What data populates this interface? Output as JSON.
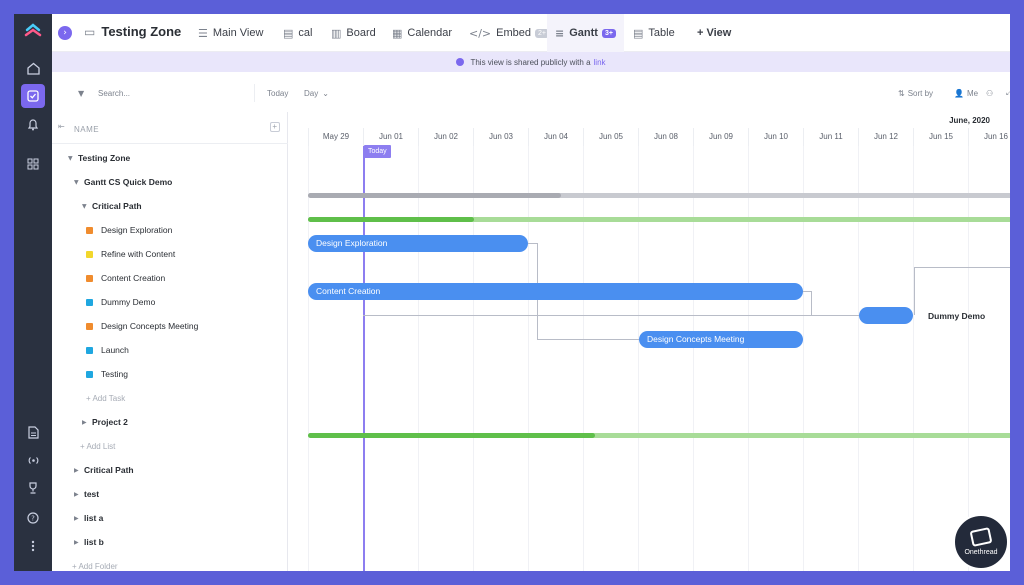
{
  "colors": {
    "accent": "#7b68ee",
    "bar_blue": "#4a8ff0",
    "green_dark": "#5fbf4a",
    "green_light": "#a8dc98",
    "progress_gray": "#b0b3bb",
    "status_orange": "#f08c2e",
    "status_yellow": "#f2d72c",
    "status_cyan": "#1fa7e0"
  },
  "rail": {
    "icons": [
      "home-icon",
      "tasks-icon",
      "bell-icon",
      "dashboard-icon",
      "doc-icon",
      "broadcast-icon",
      "trophy-icon",
      "help-icon",
      "more-icon"
    ]
  },
  "topbar": {
    "space_title": "Testing Zone",
    "tabs": [
      {
        "label": "Main View",
        "icon": "list-icon"
      },
      {
        "label": "cal",
        "icon": "stack-icon"
      },
      {
        "label": "Board",
        "icon": "board-icon"
      },
      {
        "label": "Calendar",
        "icon": "calendar-icon"
      },
      {
        "label": "Embed",
        "icon": "code-icon",
        "badge": "2+"
      },
      {
        "label": "Gantt",
        "icon": "gantt-icon",
        "badge": "3+"
      },
      {
        "label": "Table",
        "icon": "table-icon"
      }
    ],
    "add_view": "+ View"
  },
  "banner": {
    "text": "This view is shared publicly with a",
    "link": "link"
  },
  "toolbar": {
    "search_placeholder": "Search...",
    "today": "Today",
    "day": "Day",
    "sort_by": "Sort by",
    "me": "Me"
  },
  "list": {
    "header": "NAME",
    "rows": [
      {
        "label": "Testing Zone",
        "kind": "folder"
      },
      {
        "label": "Gantt CS Quick Demo",
        "kind": "list"
      },
      {
        "label": "Critical Path",
        "kind": "group"
      },
      {
        "label": "Design Exploration",
        "status": "orange"
      },
      {
        "label": "Refine with Content",
        "status": "yellow"
      },
      {
        "label": "Content Creation",
        "status": "orange"
      },
      {
        "label": "Dummy Demo",
        "status": "cyan"
      },
      {
        "label": "Design Concepts Meeting",
        "status": "orange"
      },
      {
        "label": "Launch",
        "status": "cyan"
      },
      {
        "label": "Testing",
        "status": "cyan"
      },
      {
        "label": "+ Add Task",
        "kind": "add"
      },
      {
        "label": "Project 2",
        "kind": "group"
      },
      {
        "label": "+ Add List",
        "kind": "add"
      },
      {
        "label": "Critical Path",
        "kind": "list"
      },
      {
        "label": "test",
        "kind": "list"
      },
      {
        "label": "list a",
        "kind": "list"
      },
      {
        "label": "list b",
        "kind": "list"
      },
      {
        "label": "+ Add Folder",
        "kind": "add"
      }
    ]
  },
  "gantt": {
    "month": "June, 2020",
    "days": [
      "May 29",
      "Jun 01",
      "Jun 02",
      "Jun 03",
      "Jun 04",
      "Jun 05",
      "Jun 08",
      "Jun 09",
      "Jun 10",
      "Jun 11",
      "Jun 12",
      "Jun 15",
      "Jun 16"
    ],
    "today_label": "Today",
    "bars": {
      "design_exploration": "Design Exploration",
      "content_creation": "Content Creation",
      "design_concepts_meeting": "Design Concepts Meeting",
      "dummy_demo": "Dummy Demo"
    }
  },
  "brand": {
    "name": "Onethread"
  }
}
